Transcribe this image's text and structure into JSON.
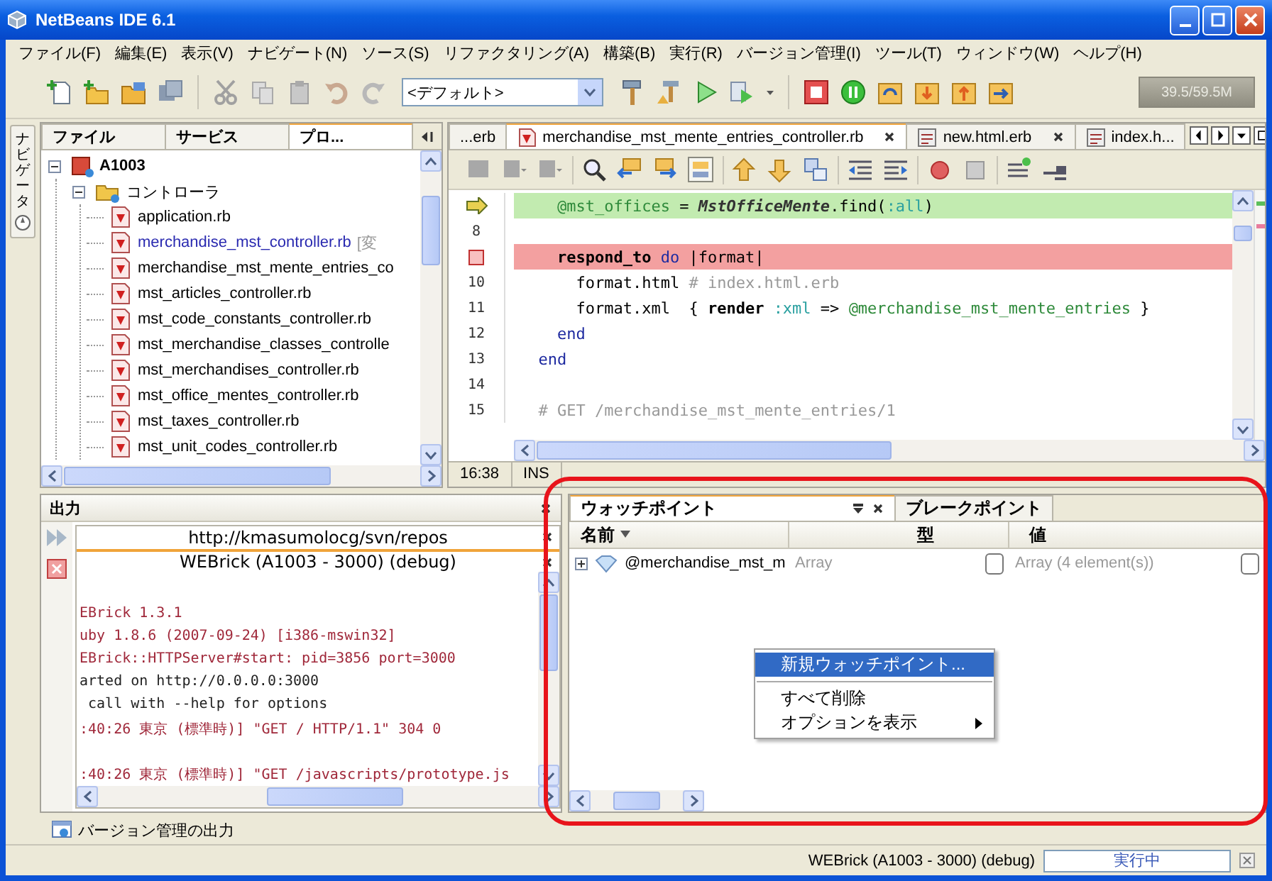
{
  "window": {
    "title": "NetBeans IDE 6.1"
  },
  "menu": [
    "ファイル(F)",
    "編集(E)",
    "表示(V)",
    "ナビゲート(N)",
    "ソース(S)",
    "リファクタリング(A)",
    "構築(B)",
    "実行(R)",
    "バージョン管理(I)",
    "ツール(T)",
    "ウィンドウ(W)",
    "ヘルプ(H)"
  ],
  "toolbar": {
    "configuration": "<デフォルト>",
    "memory": "39.5/59.5M"
  },
  "side_tab": "ナビゲータ",
  "projects": {
    "tabs": [
      {
        "label": "ファイル",
        "selected": false
      },
      {
        "label": "サービス",
        "selected": false
      },
      {
        "label": "プロ...",
        "selected": true
      }
    ],
    "tree": [
      {
        "label": "A1003",
        "kind": "project",
        "expanded": true,
        "children": [
          {
            "label": "コントローラ",
            "kind": "folder",
            "expanded": true,
            "children": [
              {
                "label": "application.rb",
                "kind": "file",
                "modified": false
              },
              {
                "label": "merchandise_mst_controller.rb",
                "kind": "file",
                "modified": true,
                "note": "[変"
              },
              {
                "label": "merchandise_mst_mente_entries_co",
                "kind": "file",
                "modified": false
              },
              {
                "label": "mst_articles_controller.rb",
                "kind": "file",
                "modified": false
              },
              {
                "label": "mst_code_constants_controller.rb",
                "kind": "file",
                "modified": false
              },
              {
                "label": "mst_merchandise_classes_controlle",
                "kind": "file",
                "modified": false
              },
              {
                "label": "mst_merchandises_controller.rb",
                "kind": "file",
                "modified": false
              },
              {
                "label": "mst_office_mentes_controller.rb",
                "kind": "file",
                "modified": false
              },
              {
                "label": "mst_taxes_controller.rb",
                "kind": "file",
                "modified": false
              },
              {
                "label": "mst_unit_codes_controller.rb",
                "kind": "file",
                "modified": false
              }
            ]
          }
        ]
      }
    ]
  },
  "editor": {
    "tabs": [
      {
        "label": "...erb",
        "selected": false,
        "closable": false
      },
      {
        "label": "merchandise_mst_mente_entries_controller.rb",
        "kind": "ruby",
        "selected": true,
        "closable": true
      },
      {
        "label": "new.html.erb",
        "kind": "erb",
        "selected": false,
        "closable": true
      },
      {
        "label": "index.h...",
        "kind": "erb",
        "selected": false,
        "closable": false
      }
    ],
    "lines": [
      {
        "kind": "current",
        "segments": [
          {
            "text": "    @mst_offices",
            "kind": "ivar"
          },
          {
            "text": " = ",
            "kind": "plain"
          },
          {
            "text": "MstOfficeMente",
            "kind": "const"
          },
          {
            "text": ".find(",
            "kind": "plain"
          },
          {
            "text": ":all",
            "kind": "symbol"
          },
          {
            "text": ")",
            "kind": "plain"
          }
        ]
      },
      {
        "kind": "plain",
        "number": "8"
      },
      {
        "kind": "breakpoint",
        "segments": [
          {
            "text": "    respond_to ",
            "kind": "method"
          },
          {
            "text": "do",
            "kind": "keyword"
          },
          {
            "text": " |format|",
            "kind": "plain"
          }
        ]
      },
      {
        "kind": "plain",
        "number": "10",
        "segments": [
          {
            "text": "      format.html",
            "kind": "plain"
          },
          {
            "text": " # index.html.erb",
            "kind": "comment"
          }
        ]
      },
      {
        "kind": "plain",
        "number": "11",
        "segments": [
          {
            "text": "      format.xml  { ",
            "kind": "plain"
          },
          {
            "text": "render ",
            "kind": "method"
          },
          {
            "text": ":xml",
            "kind": "symbol"
          },
          {
            "text": " => ",
            "kind": "plain"
          },
          {
            "text": "@merchandise_mst_mente_entries",
            "kind": "ivar"
          },
          {
            "text": " }",
            "kind": "plain"
          }
        ]
      },
      {
        "kind": "plain",
        "number": "12",
        "segments": [
          {
            "text": "    end",
            "kind": "keyword"
          }
        ]
      },
      {
        "kind": "plain",
        "number": "13",
        "segments": [
          {
            "text": "  end",
            "kind": "keyword"
          }
        ]
      },
      {
        "kind": "plain",
        "number": "14"
      },
      {
        "kind": "plain",
        "number": "15",
        "segments": [
          {
            "text": "  # GET /merchandise_mst_mente_entries/1",
            "kind": "comment"
          }
        ]
      }
    ],
    "status": {
      "position": "16:38",
      "mode": "INS"
    }
  },
  "output": {
    "title": "出力",
    "tabs": [
      {
        "label": "http://kmasumolocg/svn/repos",
        "selected": false
      },
      {
        "label": "WEBrick (A1003 - 3000) (debug)",
        "selected": true
      }
    ],
    "lines": [
      {
        "kind": "error",
        "text": "EBrick 1.3.1"
      },
      {
        "kind": "error",
        "text": "uby 1.8.6 (2007-09-24) [i386-mswin32]"
      },
      {
        "kind": "error",
        "text": "EBrick::HTTPServer#start: pid=3856 port=3000"
      },
      {
        "kind": "info",
        "text": "arted on http://0.0.0.0:3000"
      },
      {
        "kind": "info",
        "text": " call with --help for options"
      },
      {
        "kind": "error",
        "text": ":40:26 東京 (標準時)] \"GET / HTTP/1.1\" 304 0"
      },
      {
        "kind": "blank"
      },
      {
        "kind": "error",
        "text": ":40:26 東京 (標準時)] \"GET /javascripts/prototype.js"
      }
    ]
  },
  "watch": {
    "tabs": [
      {
        "label": "ウォッチポイント",
        "selected": true
      },
      {
        "label": "ブレークポイント",
        "selected": false
      }
    ],
    "columns": [
      "名前",
      "型",
      "値"
    ],
    "rows": [
      {
        "name": "@merchandise_mst_m",
        "type": "Array",
        "value": "Array (4 element(s))",
        "expanded": false
      }
    ],
    "context_menu": [
      {
        "kind": "item",
        "label": "新規ウォッチポイント...",
        "selected": true
      },
      {
        "kind": "separator"
      },
      {
        "kind": "item",
        "label": "すべて削除",
        "selected": false
      },
      {
        "kind": "submenu",
        "label": "オプションを表示",
        "selected": false
      }
    ]
  },
  "bottom_tab": "バージョン管理の出力",
  "status_bar": {
    "task": "WEBrick (A1003 - 3000) (debug)",
    "progress_label": "実行中"
  }
}
